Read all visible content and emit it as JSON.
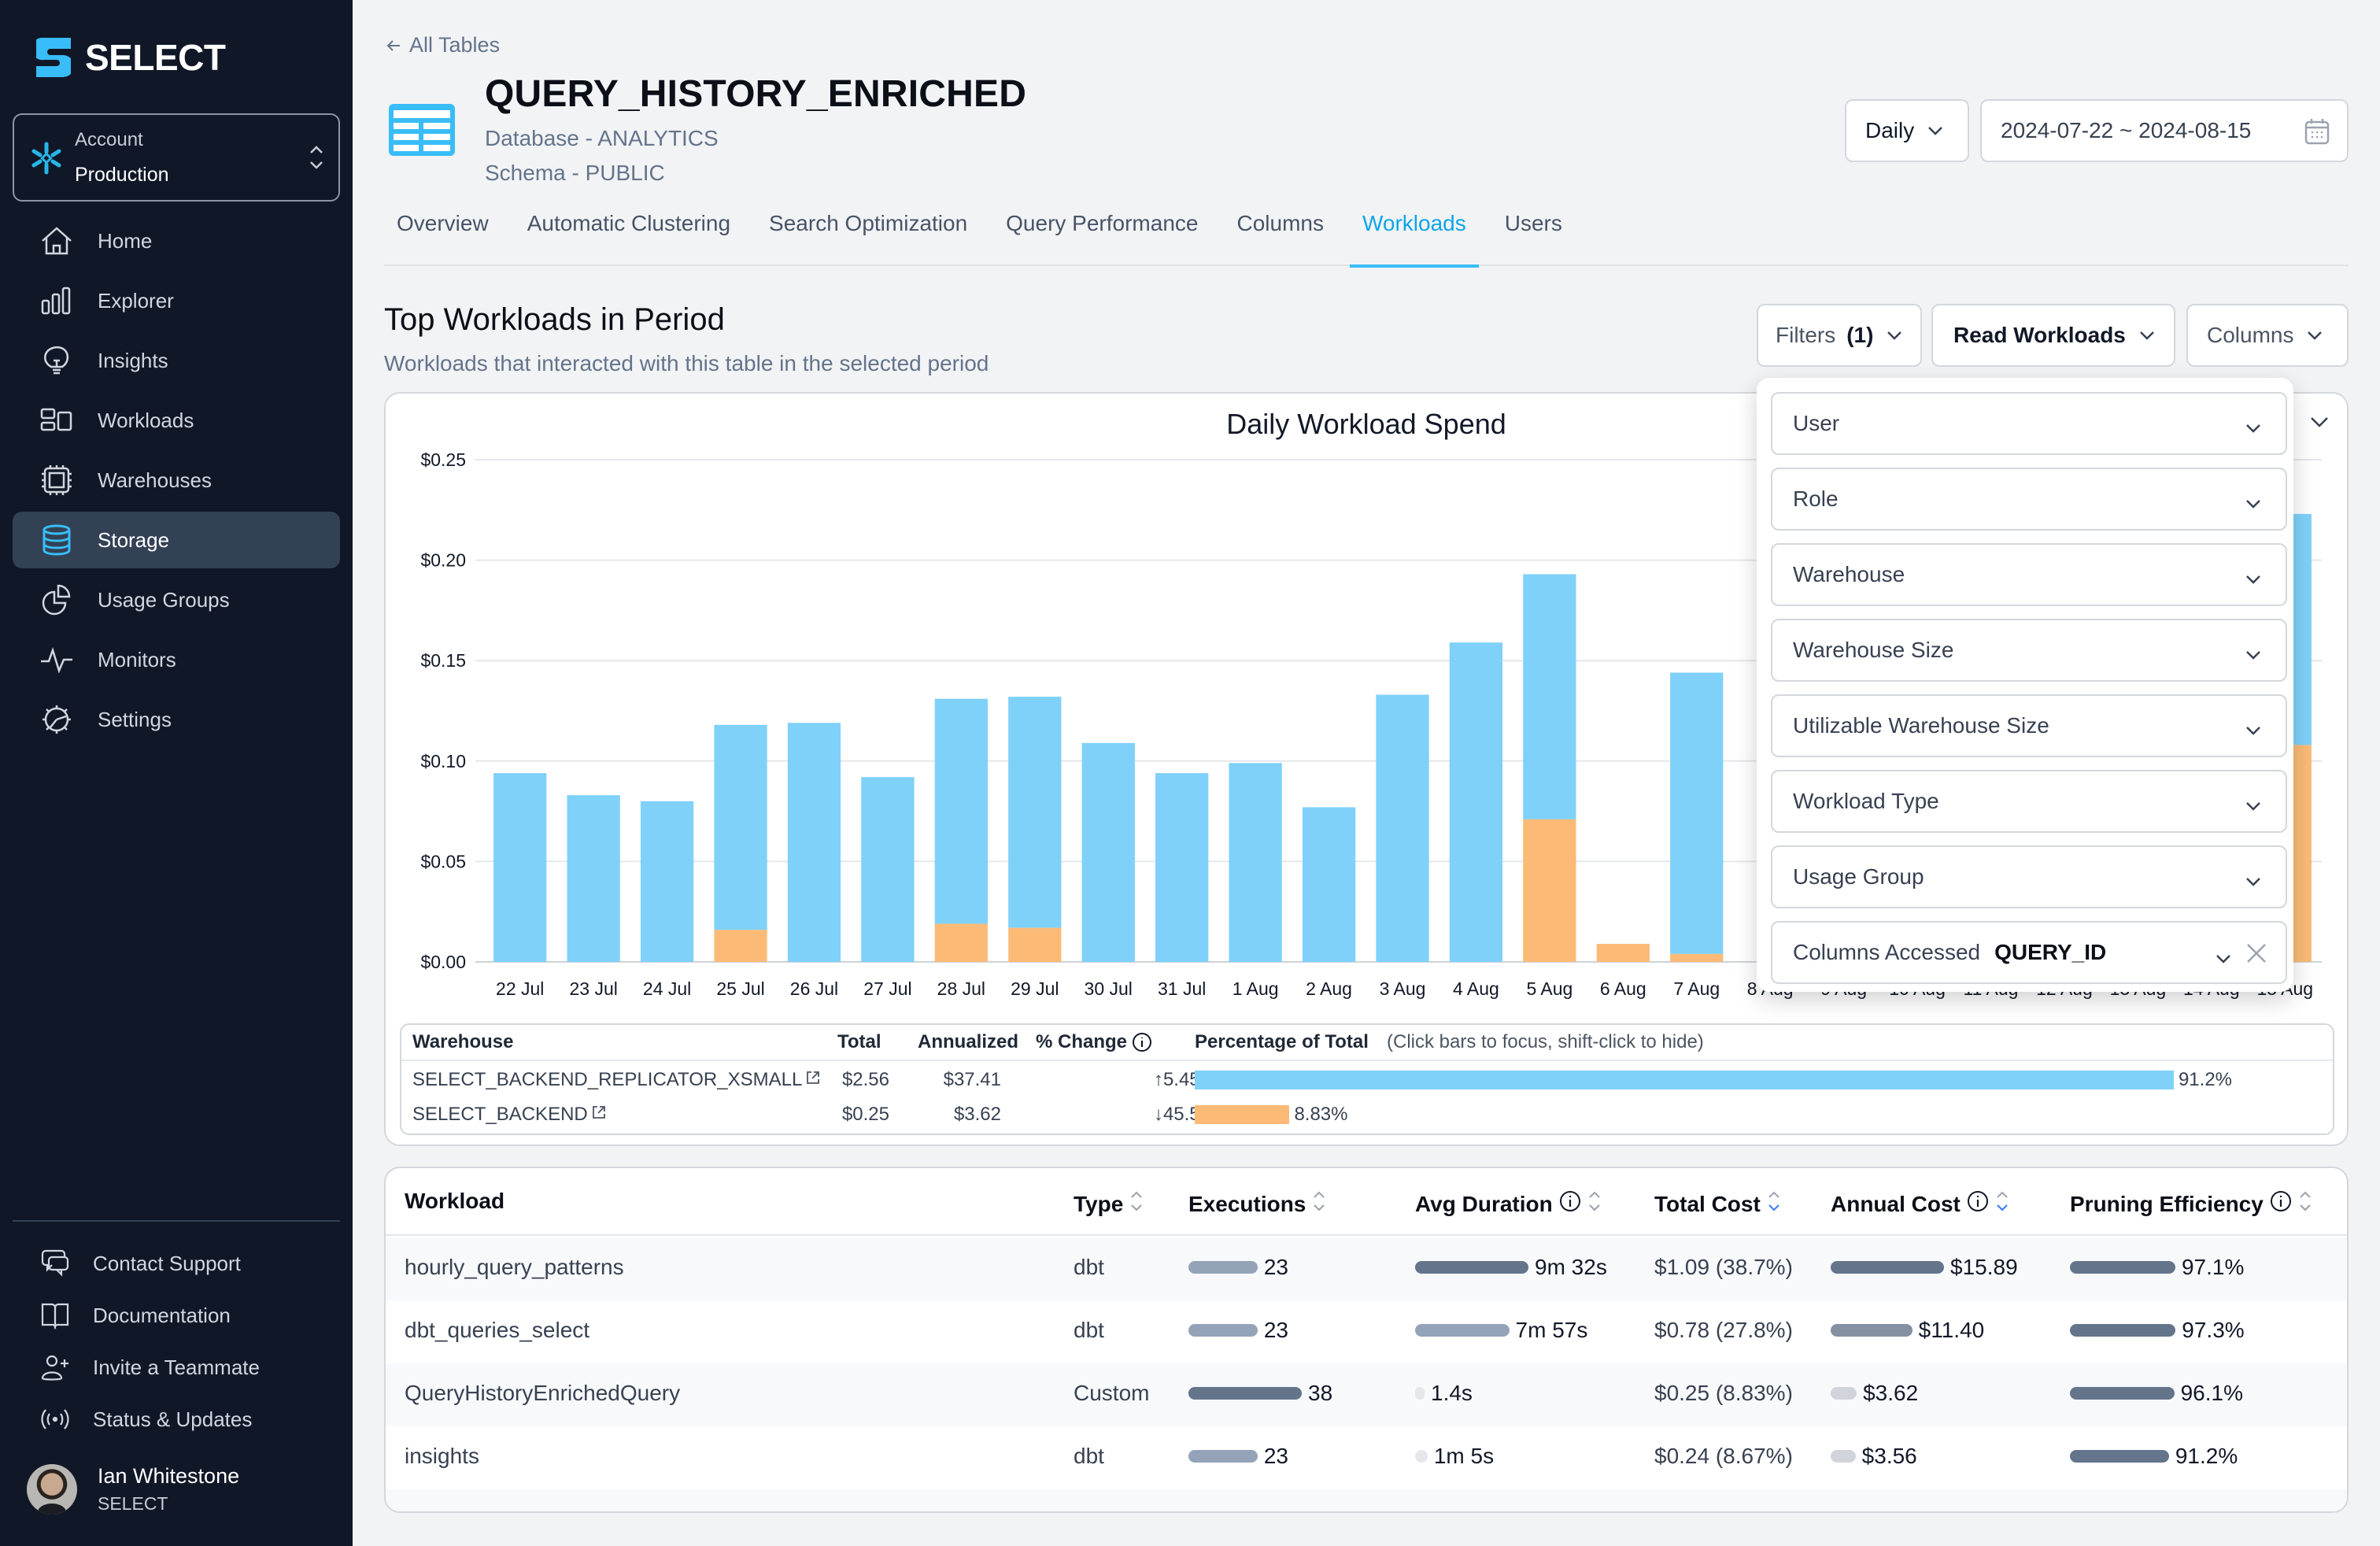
{
  "sidebar": {
    "brand": "SELECT",
    "account": {
      "label": "Account",
      "value": "Production"
    },
    "items": [
      {
        "label": "Home",
        "icon": "home-icon"
      },
      {
        "label": "Explorer",
        "icon": "bar-chart-icon"
      },
      {
        "label": "Insights",
        "icon": "lightbulb-icon"
      },
      {
        "label": "Workloads",
        "icon": "workloads-icon"
      },
      {
        "label": "Warehouses",
        "icon": "cpu-icon"
      },
      {
        "label": "Storage",
        "icon": "database-icon",
        "active": true
      },
      {
        "label": "Usage Groups",
        "icon": "pie-chart-icon"
      },
      {
        "label": "Monitors",
        "icon": "activity-icon"
      },
      {
        "label": "Settings",
        "icon": "gear-icon"
      }
    ],
    "bottom_items": [
      {
        "label": "Contact Support",
        "icon": "chat-icon"
      },
      {
        "label": "Documentation",
        "icon": "book-icon"
      },
      {
        "label": "Invite a Teammate",
        "icon": "user-plus-icon"
      },
      {
        "label": "Status & Updates",
        "icon": "broadcast-icon"
      }
    ],
    "user": {
      "name": "Ian Whitestone",
      "org": "SELECT"
    }
  },
  "header": {
    "back_label": "All Tables",
    "title": "QUERY_HISTORY_ENRICHED",
    "database": "Database - ANALYTICS",
    "schema": "Schema - PUBLIC",
    "granularity": "Daily",
    "date_range": "2024-07-22 ~ 2024-08-15"
  },
  "tabs": [
    {
      "label": "Overview"
    },
    {
      "label": "Automatic Clustering"
    },
    {
      "label": "Search Optimization"
    },
    {
      "label": "Query Performance"
    },
    {
      "label": "Columns"
    },
    {
      "label": "Workloads",
      "active": true
    },
    {
      "label": "Users"
    }
  ],
  "section": {
    "title": "Top Workloads in Period",
    "subtitle": "Workloads that interacted with this table in the selected period",
    "filters_label": "Filters",
    "filters_count": "(1)",
    "workload_mode": "Read Workloads",
    "columns_label": "Columns"
  },
  "filter_panel": {
    "fields": [
      {
        "label": "User"
      },
      {
        "label": "Role"
      },
      {
        "label": "Warehouse"
      },
      {
        "label": "Warehouse Size"
      },
      {
        "label": "Utilizable Warehouse Size"
      },
      {
        "label": "Workload Type"
      },
      {
        "label": "Usage Group"
      },
      {
        "label": "Columns Accessed",
        "value": "QUERY_ID"
      }
    ]
  },
  "chart_data": {
    "type": "bar",
    "stacked": true,
    "title": "Daily Workload Spend",
    "xlabel": "",
    "ylabel": "",
    "ylim": [
      0,
      0.25
    ],
    "yticks": [
      "$0.00",
      "$0.05",
      "$0.10",
      "$0.15",
      "$0.20",
      "$0.25"
    ],
    "grid": true,
    "categories": [
      "22 Jul",
      "23 Jul",
      "24 Jul",
      "25 Jul",
      "26 Jul",
      "27 Jul",
      "28 Jul",
      "29 Jul",
      "30 Jul",
      "31 Jul",
      "1 Aug",
      "2 Aug",
      "3 Aug",
      "4 Aug",
      "5 Aug",
      "6 Aug",
      "7 Aug",
      "8 Aug",
      "9 Aug",
      "10 Aug",
      "11 Aug",
      "12 Aug",
      "13 Aug",
      "14 Aug",
      "15 Aug"
    ],
    "series": [
      {
        "name": "SELECT_BACKEND",
        "color": "#fbbb77",
        "values": [
          0,
          0,
          0,
          0.016,
          0,
          0,
          0.019,
          0.017,
          0,
          0,
          0,
          0,
          0,
          0,
          0.071,
          0.009,
          0.004,
          null,
          null,
          null,
          null,
          null,
          null,
          null,
          0.108
        ]
      },
      {
        "name": "SELECT_BACKEND_REPLICATOR_XSMALL",
        "color": "#7fd1fa",
        "values": [
          0.094,
          0.083,
          0.08,
          0.102,
          0.119,
          0.092,
          0.112,
          0.115,
          0.109,
          0.094,
          0.099,
          0.077,
          0.133,
          0.159,
          0.122,
          0,
          0.14,
          null,
          null,
          null,
          null,
          null,
          null,
          null,
          0.115
        ]
      }
    ]
  },
  "warehouse_legend": {
    "headers": {
      "warehouse": "Warehouse",
      "total": "Total",
      "annualized": "Annualized",
      "change": "% Change",
      "pct": "Percentage of Total",
      "hint": "(Click bars to focus, shift-click to hide)"
    },
    "rows": [
      {
        "name": "SELECT_BACKEND_REPLICATOR_XSMALL",
        "total": "$2.56",
        "annualized": "$37.41",
        "change": "5.45%",
        "direction": "up",
        "pct_label": "91.2%",
        "pct": 91.2,
        "color": "#7fd1fa"
      },
      {
        "name": "SELECT_BACKEND",
        "total": "$0.25",
        "annualized": "$3.62",
        "change": "45.5%",
        "direction": "down",
        "pct_label": "8.83%",
        "pct": 8.83,
        "color": "#fbbb77"
      }
    ]
  },
  "workloads_table": {
    "headers": {
      "workload": "Workload",
      "type": "Type",
      "executions": "Executions",
      "avg_duration": "Avg Duration",
      "total_cost": "Total Cost",
      "annual_cost": "Annual Cost",
      "pruning": "Pruning Efficiency"
    },
    "sorted_by": "Total Cost",
    "rows": [
      {
        "workload": "hourly_query_patterns",
        "type": "dbt",
        "executions": "23",
        "exec_frac": 0.61,
        "avg_duration": "9m 32s",
        "dur_frac": 1.0,
        "total_cost": "$1.09 (38.7%)",
        "annual_cost": "$15.89",
        "annual_frac": 1.0,
        "pruning": "97.1%",
        "pruning_frac": 0.971
      },
      {
        "workload": "dbt_queries_select",
        "type": "dbt",
        "executions": "23",
        "exec_frac": 0.61,
        "avg_duration": "7m 57s",
        "dur_frac": 0.83,
        "total_cost": "$0.78 (27.8%)",
        "annual_cost": "$11.40",
        "annual_frac": 0.72,
        "pruning": "97.3%",
        "pruning_frac": 0.973
      },
      {
        "workload": "QueryHistoryEnrichedQuery",
        "type": "Custom",
        "executions": "38",
        "exec_frac": 1.0,
        "avg_duration": "1.4s",
        "dur_frac": 0.01,
        "total_cost": "$0.25 (8.83%)",
        "annual_cost": "$3.62",
        "annual_frac": 0.23,
        "pruning": "96.1%",
        "pruning_frac": 0.961
      },
      {
        "workload": "insights",
        "type": "dbt",
        "executions": "23",
        "exec_frac": 0.61,
        "avg_duration": "1m 5s",
        "dur_frac": 0.11,
        "total_cost": "$0.24 (8.67%)",
        "annual_cost": "$3.56",
        "annual_frac": 0.22,
        "pruning": "91.2%",
        "pruning_frac": 0.912
      }
    ]
  }
}
